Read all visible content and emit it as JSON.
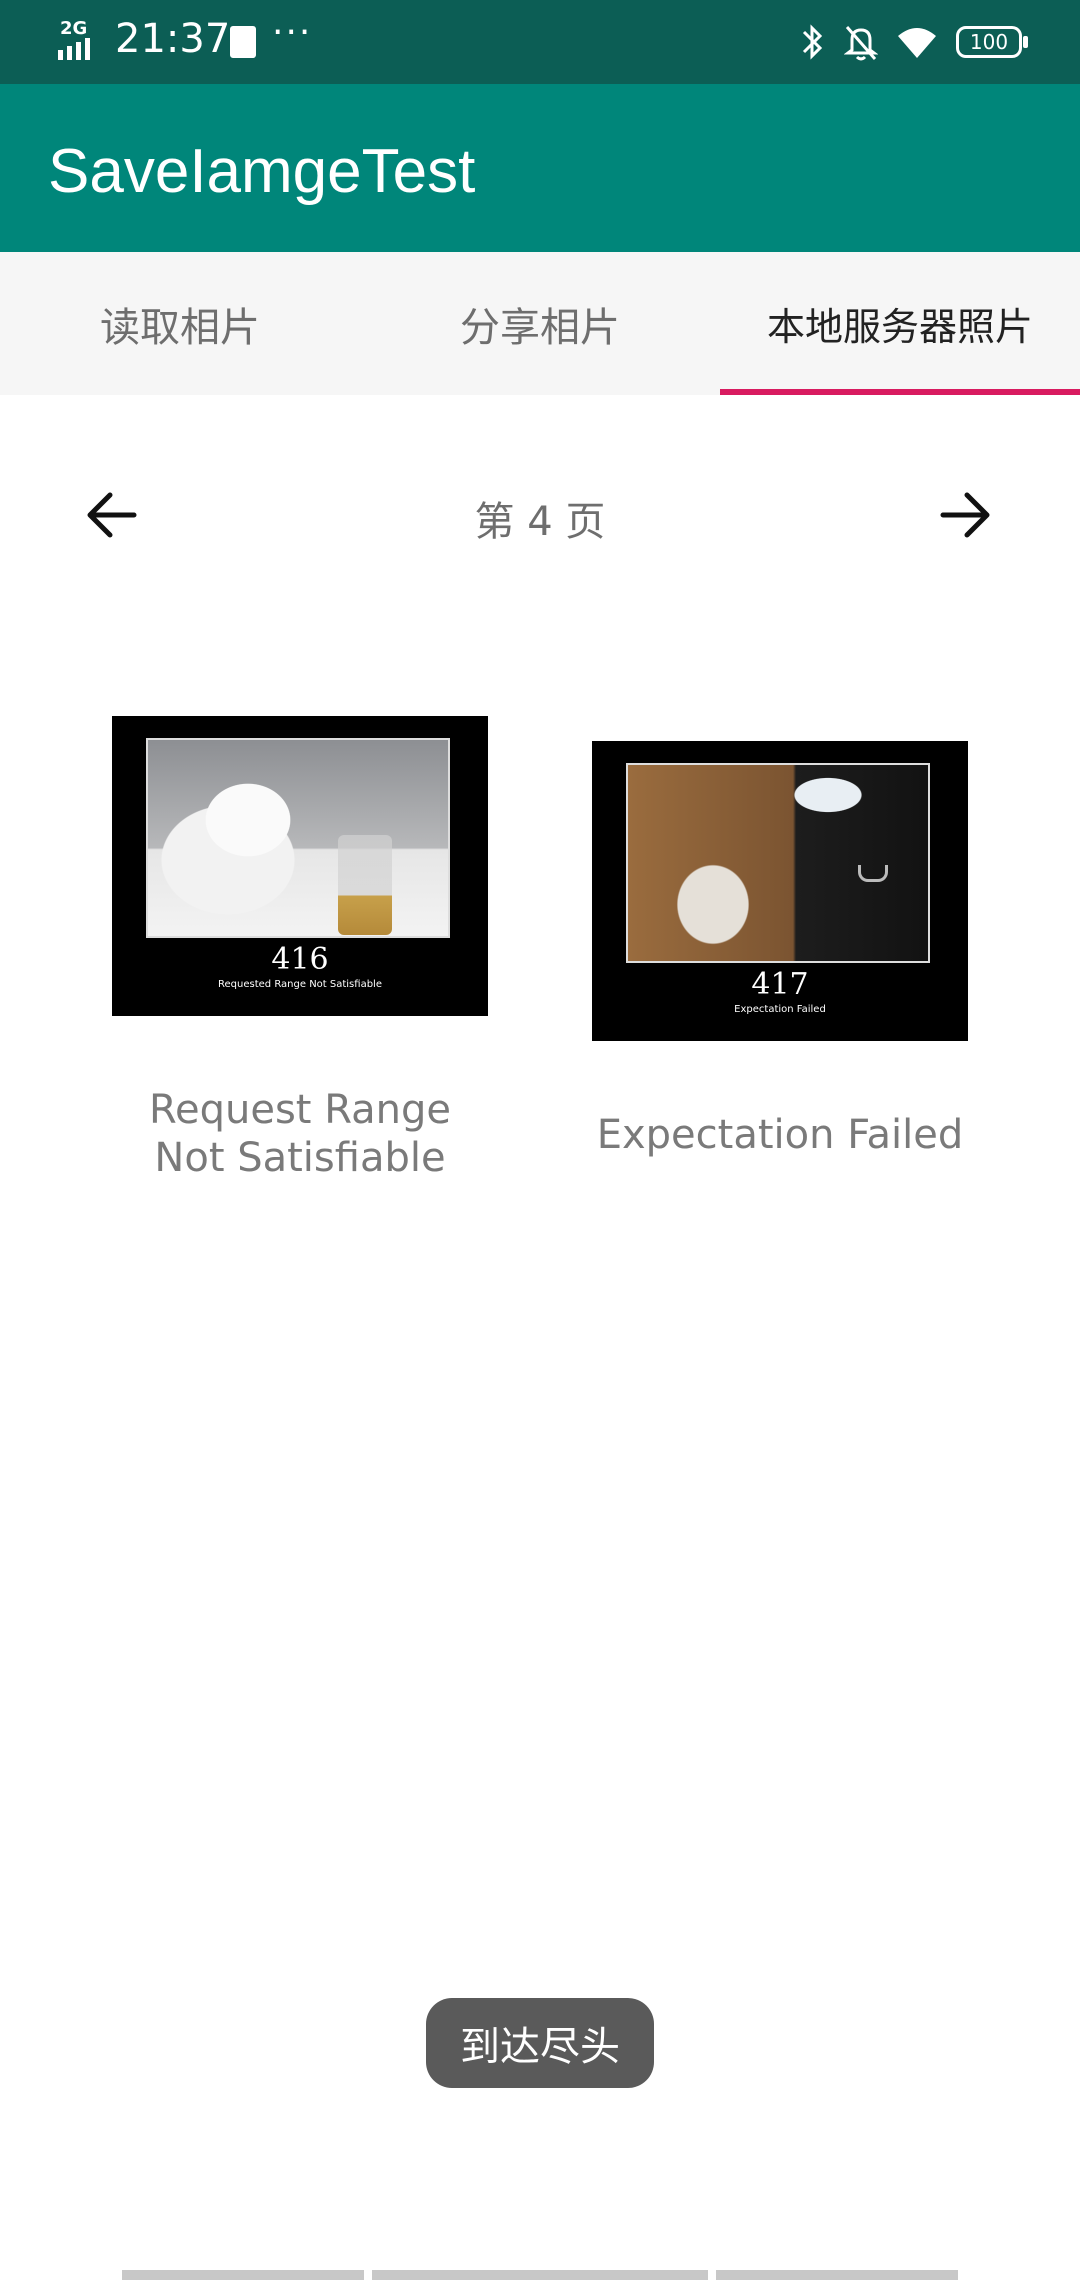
{
  "status_bar": {
    "network": "2G",
    "time": "21:37",
    "more": "···",
    "battery": "100"
  },
  "app_bar": {
    "title": "SaveIamgeTest"
  },
  "tabs": [
    {
      "label": "读取相片",
      "active": false
    },
    {
      "label": "分享相片",
      "active": false
    },
    {
      "label": "本地服务器照片",
      "active": true
    }
  ],
  "pager": {
    "page_label": "第 4 页"
  },
  "items": [
    {
      "code": "416",
      "poster_subtitle": "Requested Range Not Satisfiable",
      "caption": "Request Range Not Satisfiable"
    },
    {
      "code": "417",
      "poster_subtitle": "Expectation Failed",
      "caption": "Expectation Failed"
    }
  ],
  "toast": {
    "text": "到达尽头"
  },
  "colors": {
    "status_bar": "#0c5e55",
    "app_bar": "#00867a",
    "tab_indicator": "#d81b60",
    "toast": "#5a5a5a"
  }
}
